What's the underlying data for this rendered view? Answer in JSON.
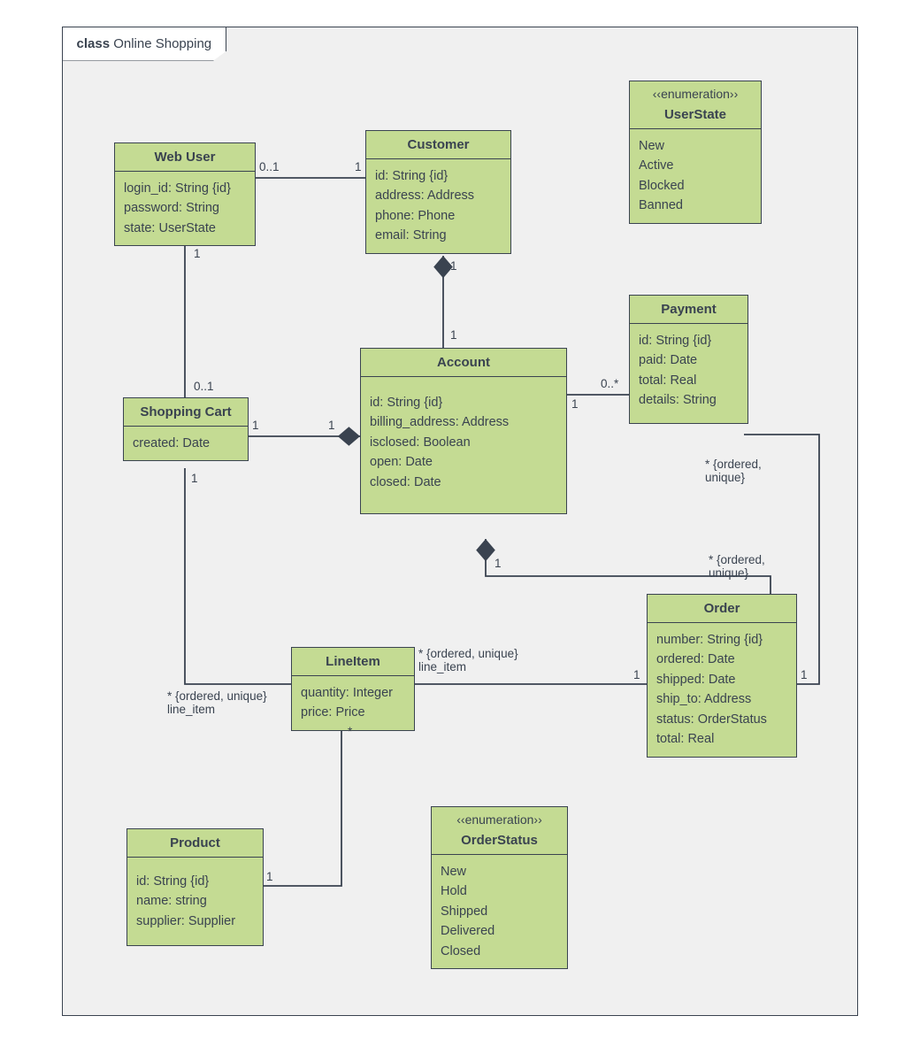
{
  "diagram": {
    "label_prefix": "class",
    "label_name": "Online Shopping"
  },
  "webuser": {
    "name": "Web User",
    "attrs": {
      "a0": "login_id: String {id}",
      "a1": "password: String",
      "a2": "state: UserState"
    }
  },
  "customer": {
    "name": "Customer",
    "attrs": {
      "a0": "id: String {id}",
      "a1": "address: Address",
      "a2": "phone: Phone",
      "a3": "email: String"
    }
  },
  "userstate": {
    "stereo": "‹‹enumeration››",
    "name": "UserState",
    "vals": {
      "v0": "New",
      "v1": "Active",
      "v2": "Blocked",
      "v3": "Banned"
    }
  },
  "cart": {
    "name": "Shopping Cart",
    "attrs": {
      "a0": "created: Date"
    }
  },
  "account": {
    "name": "Account",
    "attrs": {
      "a0": "id: String {id}",
      "a1": "billing_address: Address",
      "a2": "isclosed: Boolean",
      "a3": "open: Date",
      "a4": "closed: Date"
    }
  },
  "payment": {
    "name": "Payment",
    "attrs": {
      "a0": "id: String {id}",
      "a1": "paid: Date",
      "a2": "total: Real",
      "a3": "details: String"
    }
  },
  "lineitem": {
    "name": "LineItem",
    "attrs": {
      "a0": "quantity: Integer",
      "a1": "price: Price"
    }
  },
  "order": {
    "name": "Order",
    "attrs": {
      "a0": "number: String {id}",
      "a1": "ordered: Date",
      "a2": "shipped: Date",
      "a3": "ship_to: Address",
      "a4": "status: OrderStatus",
      "a5": "total: Real"
    }
  },
  "product": {
    "name": "Product",
    "attrs": {
      "a0": "id: String {id}",
      "a1": "name: string",
      "a2": "supplier: Supplier"
    }
  },
  "orderstatus": {
    "stereo": "‹‹enumeration››",
    "name": "OrderStatus",
    "vals": {
      "v0": "New",
      "v1": "Hold",
      "v2": "Shipped",
      "v3": "Delivered",
      "v4": "Closed"
    }
  },
  "mult": {
    "wu_c_left": "0..1",
    "wu_c_right": "1",
    "wu_cart_top": "1",
    "wu_cart_bot": "0..1",
    "cust_acct_top": "1",
    "cust_acct_bot": "1",
    "cart_acct_left": "1",
    "cart_acct_right": "1",
    "acct_pay_left": "1",
    "acct_pay_right": "0..*",
    "acct_order_left": "1",
    "acct_order_right": "* {ordered,\nunique}",
    "pay_order_top": "* {ordered,\nunique}",
    "pay_order_bot": "1",
    "cart_line_top": "1",
    "cart_line_bot": "* {ordered, unique}\nline_item",
    "order_line_right": "1",
    "order_line_left": "* {ordered, unique}\nline_item",
    "line_prod_top": "*",
    "line_prod_bot": "1"
  }
}
